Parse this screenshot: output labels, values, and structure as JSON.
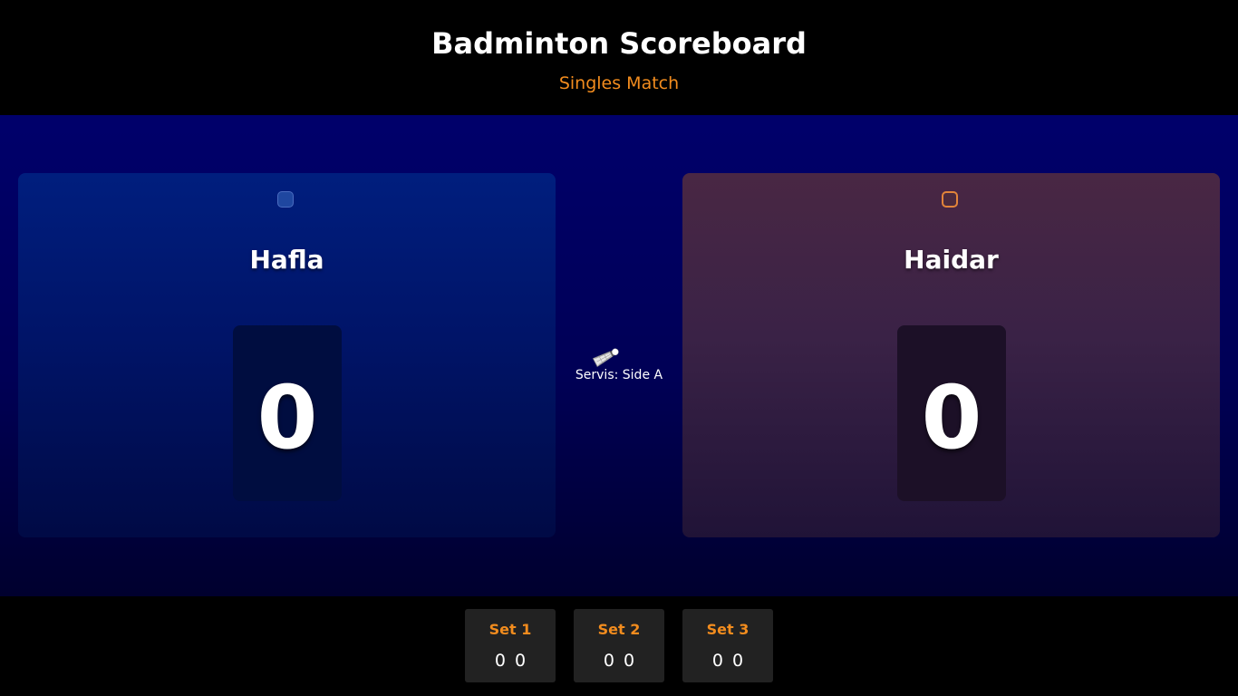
{
  "header": {
    "title": "Badminton Scoreboard",
    "subtitle": "Singles Match"
  },
  "players": [
    {
      "name": "Hafla",
      "score": "0",
      "color": "#001e7e"
    },
    {
      "name": "Haidar",
      "score": "0",
      "color": "#492744"
    }
  ],
  "serve": {
    "icon": "shuttlecock-icon",
    "text": "Servis: Side A"
  },
  "sets": [
    {
      "label": "Set 1",
      "score_a": "0",
      "score_b": "0"
    },
    {
      "label": "Set 2",
      "score_a": "0",
      "score_b": "0"
    },
    {
      "label": "Set 3",
      "score_a": "0",
      "score_b": "0"
    }
  ],
  "colors": {
    "accent": "#f28c1e",
    "court_bg": "#000060"
  }
}
